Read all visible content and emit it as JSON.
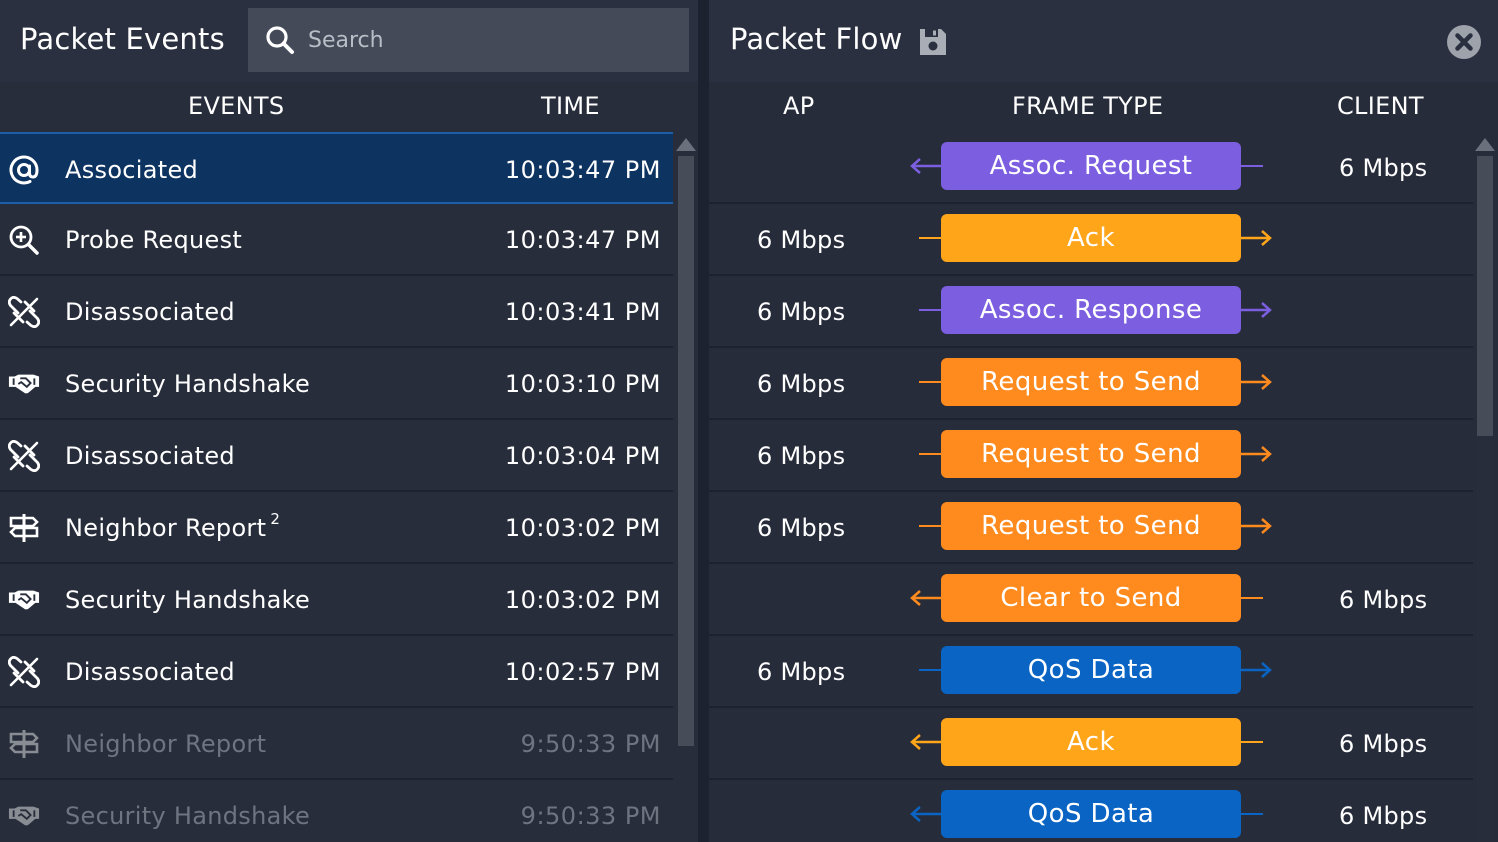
{
  "left_panel": {
    "title": "Packet Events",
    "search": {
      "placeholder": "Search",
      "value": ""
    },
    "columns": {
      "events": "EVENTS",
      "time": "TIME"
    },
    "events": [
      {
        "label": "Associated",
        "time": "10:03:47 PM",
        "icon": "at-sign-icon",
        "selected": true,
        "dim": false,
        "badge": ""
      },
      {
        "label": "Probe Request",
        "time": "10:03:47 PM",
        "icon": "zoom-in-icon",
        "selected": false,
        "dim": false,
        "badge": ""
      },
      {
        "label": "Disassociated",
        "time": "10:03:41 PM",
        "icon": "broken-link-icon",
        "selected": false,
        "dim": false,
        "badge": ""
      },
      {
        "label": "Security Handshake",
        "time": "10:03:10 PM",
        "icon": "handshake-icon",
        "selected": false,
        "dim": false,
        "badge": ""
      },
      {
        "label": "Disassociated",
        "time": "10:03:04 PM",
        "icon": "broken-link-icon",
        "selected": false,
        "dim": false,
        "badge": ""
      },
      {
        "label": "Neighbor Report",
        "time": "10:03:02 PM",
        "icon": "signpost-icon",
        "selected": false,
        "dim": false,
        "badge": "2"
      },
      {
        "label": "Security Handshake",
        "time": "10:03:02 PM",
        "icon": "handshake-icon",
        "selected": false,
        "dim": false,
        "badge": ""
      },
      {
        "label": "Disassociated",
        "time": "10:02:57 PM",
        "icon": "broken-link-icon",
        "selected": false,
        "dim": false,
        "badge": ""
      },
      {
        "label": "Neighbor Report",
        "time": "9:50:33 PM",
        "icon": "signpost-icon",
        "selected": false,
        "dim": true,
        "badge": ""
      },
      {
        "label": "Security Handshake",
        "time": "9:50:33 PM",
        "icon": "handshake-icon",
        "selected": false,
        "dim": true,
        "badge": ""
      }
    ]
  },
  "right_panel": {
    "title": "Packet Flow",
    "save_icon": "save-icon",
    "close_icon": "close-icon",
    "columns": {
      "ap": "AP",
      "frame_type": "FRAME TYPE",
      "client": "CLIENT"
    },
    "colors": {
      "purple": "#7b5fe0",
      "amber": "#ffa51a",
      "orange": "#ff8a1e",
      "blue": "#0a64c4"
    },
    "frames": [
      {
        "frame": "Assoc. Request",
        "ap": "",
        "client": "6 Mbps",
        "direction": "to-ap",
        "color": "purple"
      },
      {
        "frame": "Ack",
        "ap": "6 Mbps",
        "client": "",
        "direction": "to-client",
        "color": "amber"
      },
      {
        "frame": "Assoc. Response",
        "ap": "6 Mbps",
        "client": "",
        "direction": "to-client",
        "color": "purple"
      },
      {
        "frame": "Request to Send",
        "ap": "6 Mbps",
        "client": "",
        "direction": "to-client",
        "color": "orange"
      },
      {
        "frame": "Request to Send",
        "ap": "6 Mbps",
        "client": "",
        "direction": "to-client",
        "color": "orange"
      },
      {
        "frame": "Request to Send",
        "ap": "6 Mbps",
        "client": "",
        "direction": "to-client",
        "color": "orange"
      },
      {
        "frame": "Clear to Send",
        "ap": "",
        "client": "6 Mbps",
        "direction": "to-ap",
        "color": "orange"
      },
      {
        "frame": "QoS Data",
        "ap": "6 Mbps",
        "client": "",
        "direction": "to-client",
        "color": "blue"
      },
      {
        "frame": "Ack",
        "ap": "",
        "client": "6 Mbps",
        "direction": "to-ap",
        "color": "amber"
      },
      {
        "frame": "QoS Data",
        "ap": "",
        "client": "6 Mbps",
        "direction": "to-ap",
        "color": "blue"
      }
    ]
  }
}
